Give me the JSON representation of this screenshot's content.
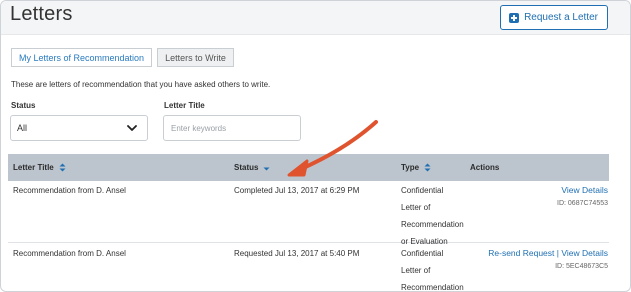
{
  "header": {
    "title": "Letters",
    "request_button": "Request a Letter"
  },
  "tabs": [
    {
      "label": "My Letters of Recommendation",
      "active": true
    },
    {
      "label": "Letters to Write",
      "active": false
    }
  ],
  "intro_text": "These are letters of recommendation that you have asked others to write.",
  "filters": {
    "status_label": "Status",
    "status_value": "All",
    "title_label": "Letter Title",
    "title_placeholder": "Enter keywords"
  },
  "table": {
    "columns": [
      "Letter Title",
      "Status",
      "Type",
      "Actions"
    ],
    "rows": [
      {
        "title": "Recommendation from D. Ansel",
        "status": "Completed Jul 13, 2017 at 6:29 PM",
        "type": [
          "Confidential",
          "Letter of",
          "Recommendation",
          "or Evaluation"
        ],
        "action_primary": "View Details",
        "action_secondary": "",
        "id": "ID: 0687C74553"
      },
      {
        "title": "Recommendation from D. Ansel",
        "status": "Requested Jul 13, 2017 at 5:40 PM",
        "type": [
          "Confidential",
          "Letter of",
          "Recommendation"
        ],
        "action_primary": "Re-send Request",
        "action_sep": "|",
        "action_secondary": "View Details",
        "id": "ID: 5EC48673C5"
      }
    ]
  },
  "colors": {
    "accent": "#1f6fb2",
    "table_header": "#bcc5ce",
    "annotation_arrow": "#e0532f"
  }
}
